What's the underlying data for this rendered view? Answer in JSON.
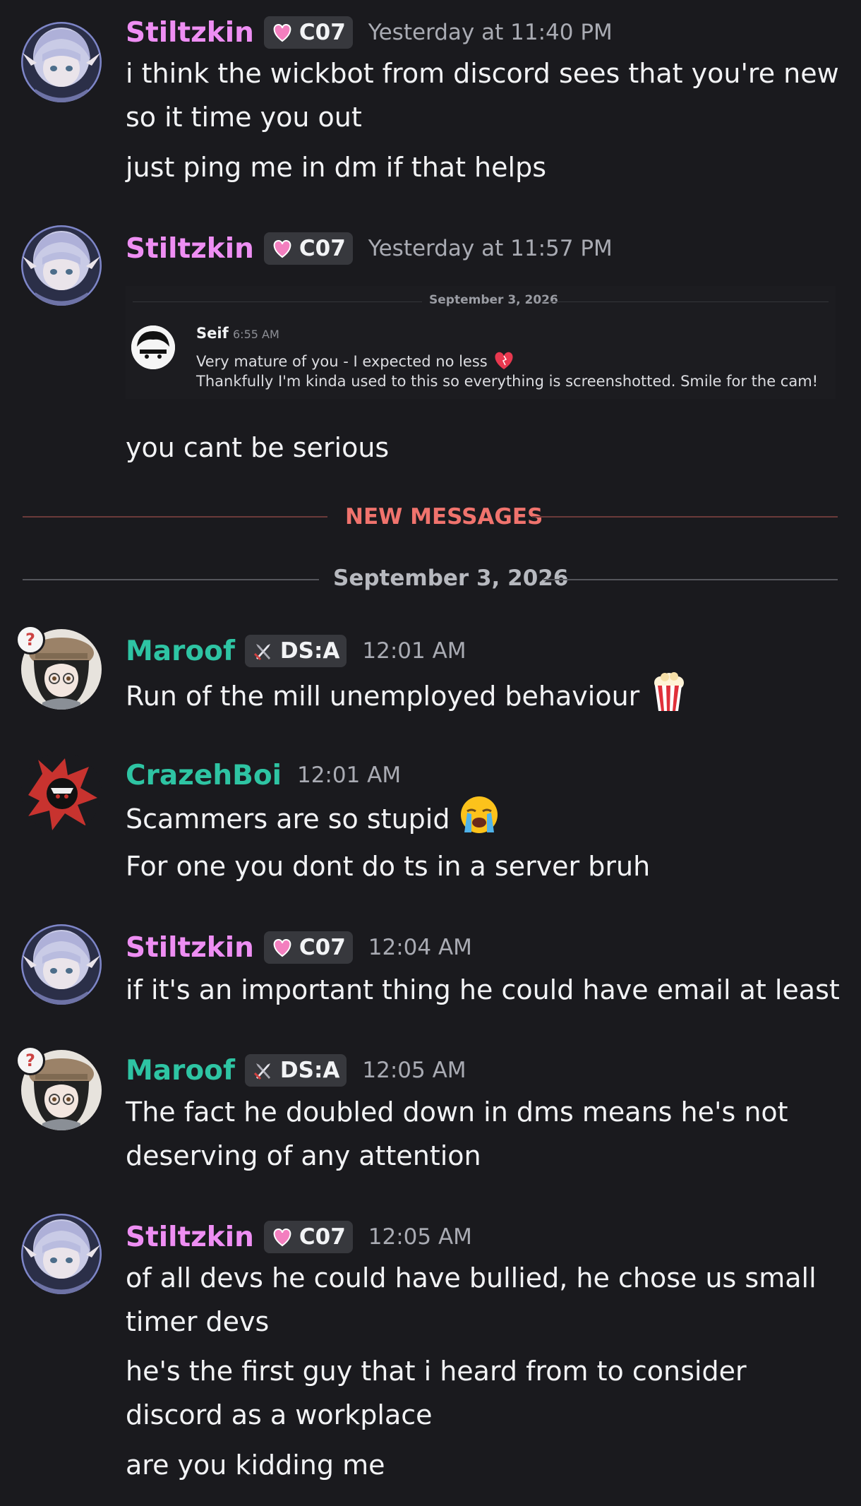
{
  "messages": [
    {
      "author": "Stiltzkin",
      "tag": "C07",
      "time": "Yesterday at 11:40 PM",
      "lines": [
        "i think the wickbot from discord sees that you're new",
        "so it time you out",
        "just ping me in dm if that helps"
      ]
    },
    {
      "author": "Stiltzkin",
      "tag": "C07",
      "time": "Yesterday at 11:57 PM",
      "embed": {
        "date": "September 3, 2026",
        "author": "Seif",
        "time": "6:55 AM",
        "line1": "Very mature of you - I expected no less",
        "line2": "Thankfully I'm kinda used to this so everything is screenshotted. Smile for the cam!"
      },
      "lines": [
        "you cant be serious"
      ]
    },
    {
      "author": "Maroof",
      "tag": "DS:A",
      "time": "12:01 AM",
      "lines": [
        "Run of the mill unemployed behaviour"
      ]
    },
    {
      "author": "CrazehBoi",
      "time": "12:01 AM",
      "lines": [
        "Scammers are so stupid",
        "For one you dont do ts in a server bruh"
      ]
    },
    {
      "author": "Stiltzkin",
      "tag": "C07",
      "time": "12:04 AM",
      "lines": [
        "if it's an important thing he could have email at least"
      ]
    },
    {
      "author": "Maroof",
      "tag": "DS:A",
      "time": "12:05 AM",
      "lines": [
        "The fact he doubled down in dms means he's not",
        "deserving of any attention"
      ]
    },
    {
      "author": "Stiltzkin",
      "tag": "C07",
      "time": "12:05 AM",
      "lines": [
        "of all devs he could have bullied, he chose us small",
        "timer devs",
        "he's the first guy that i heard from to consider",
        "discord as a workplace",
        "are you kidding me"
      ]
    }
  ],
  "dividers": {
    "new_messages": "NEW MESSAGES",
    "date": "September 3, 2026"
  },
  "colors": {
    "background": "#1a1a1e",
    "stiltzkin_name": "#ee8ef3",
    "maroof_name": "#2ec4a3",
    "crazehboi_name": "#2ec4a3",
    "new_messages": "#f0736d"
  },
  "icons": {
    "c07_tag": "pink-heart-icon",
    "dsa_tag": "crossed-swords-icon",
    "popcorn": "popcorn-emoji",
    "crying": "loudly-crying-emoji",
    "heart": "heart-emoji"
  }
}
